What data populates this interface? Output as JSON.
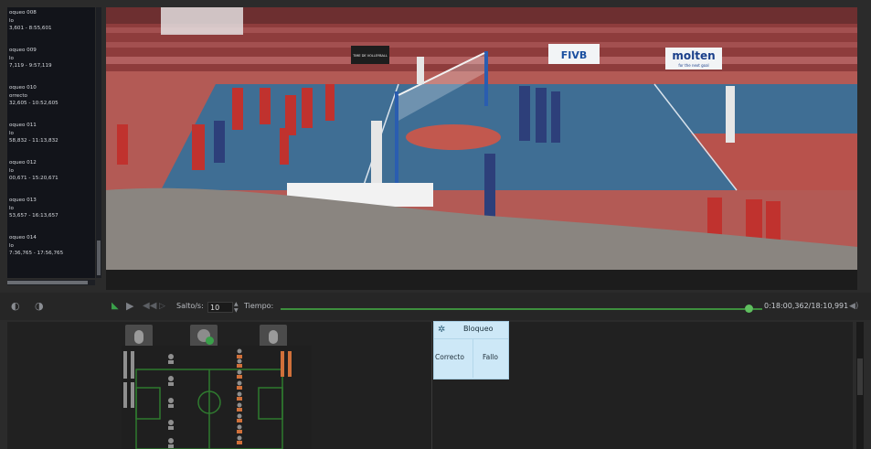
{
  "event_list": {
    "items": [
      {
        "name": "oqueo 008",
        "type": "lo",
        "range": "3,601 - 8:55,601"
      },
      {
        "name": "oqueo 009",
        "type": "lo",
        "range": "7,119 - 9:57,119"
      },
      {
        "name": "oqueo 010",
        "type": "orrecto",
        "range": "32,605 - 10:52,605"
      },
      {
        "name": "oqueo 011",
        "type": "lo",
        "range": "58,832 - 11:13,832"
      },
      {
        "name": "oqueo 012",
        "type": "lo",
        "range": "00,671 - 15:20,671"
      },
      {
        "name": "oqueo 013",
        "type": "lo",
        "range": "53,657 - 16:13,657"
      },
      {
        "name": "oqueo 014",
        "type": "lo",
        "range": "7:36,765 - 17:56,765"
      }
    ]
  },
  "video": {
    "banners": {
      "fivb": "FIVB",
      "molten": "molten",
      "molten_tagline": "for the next goal",
      "dark_banner": "TIME DE VOLLEYBALL"
    }
  },
  "player_bar": {
    "salto_label": "Salto/s:",
    "salto_value": "10",
    "tiempo_label": "Tiempo:",
    "time_readout": "0:18:00,362/18:10,991",
    "progress_fraction": 0.99
  },
  "bloqueo_card": {
    "title": "Bloqueo",
    "option_correct": "Correcto",
    "option_fail": "Fallo"
  },
  "colors": {
    "accent_green": "#3aa04a",
    "card_bg": "#cde8f7",
    "court_blue": "#3f6e94",
    "panel_dark": "#212121"
  },
  "icons": {
    "prev": "previous-icon",
    "next": "next-icon",
    "play": "play-icon",
    "rewind": "rewind-icon",
    "volume": "volume-icon",
    "bloqueo": "players-icon"
  }
}
